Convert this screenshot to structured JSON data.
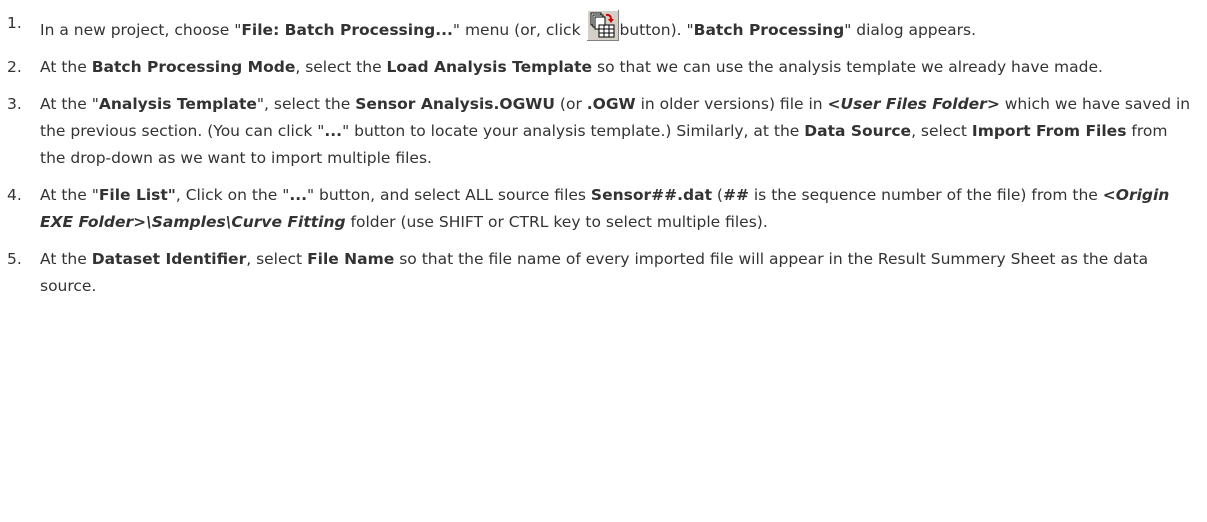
{
  "steps": [
    {
      "num": "1.",
      "parts": [
        {
          "t": "In a new project, choose \""
        },
        {
          "t": "File: Batch Processing...",
          "s": "b"
        },
        {
          "t": "\" menu (or, click "
        },
        {
          "icon": "batch-processing-button"
        },
        {
          "t": "button). \""
        },
        {
          "t": "Batch Processing",
          "s": "b"
        },
        {
          "t": "\" dialog appears."
        }
      ]
    },
    {
      "num": "2.",
      "parts": [
        {
          "t": "At the "
        },
        {
          "t": "Batch Processing Mode",
          "s": "b"
        },
        {
          "t": ", select the "
        },
        {
          "t": "Load Analysis Template",
          "s": "b"
        },
        {
          "t": " so that we can use the analysis template we already have made."
        }
      ]
    },
    {
      "num": "3.",
      "parts": [
        {
          "t": "At the \""
        },
        {
          "t": "Analysis Template",
          "s": "b"
        },
        {
          "t": "\", select the "
        },
        {
          "t": "Sensor Analysis.OGWU",
          "s": "b"
        },
        {
          "t": " (or "
        },
        {
          "t": ".OGW",
          "s": "b"
        },
        {
          "t": " in older versions) file in "
        },
        {
          "t": "<User Files Folder>",
          "s": "bi"
        },
        {
          "t": " which we have saved in the previous section. (You can click \""
        },
        {
          "t": "...",
          "s": "b"
        },
        {
          "t": "\" button to locate your analysis template.) Similarly, at the "
        },
        {
          "t": "Data Source",
          "s": "b"
        },
        {
          "t": ", select "
        },
        {
          "t": "Import From Files",
          "s": "b"
        },
        {
          "t": " from the drop-down as we want to import multiple files."
        }
      ]
    },
    {
      "num": "4.",
      "parts": [
        {
          "t": "At the \""
        },
        {
          "t": "File List\"",
          "s": "b"
        },
        {
          "t": ", Click on the \""
        },
        {
          "t": "...",
          "s": "b"
        },
        {
          "t": "\" button, and select ALL source files "
        },
        {
          "t": "Sensor##.dat",
          "s": "b"
        },
        {
          "t": " ("
        },
        {
          "t": "##",
          "s": "b"
        },
        {
          "t": " is the sequence number of the file) from the "
        },
        {
          "t": "<Origin EXE Folder>\\Samples\\Curve Fitting",
          "s": "bi"
        },
        {
          "t": " folder (use SHIFT or CTRL key to select multiple files)."
        }
      ]
    },
    {
      "num": "5.",
      "parts": [
        {
          "t": "At the "
        },
        {
          "t": "Dataset Identifier",
          "s": "b"
        },
        {
          "t": ", select "
        },
        {
          "t": "File Name",
          "s": "b"
        },
        {
          "t": " so that the file name of every imported file will appear in the Result Summery Sheet as the data source."
        }
      ]
    }
  ]
}
